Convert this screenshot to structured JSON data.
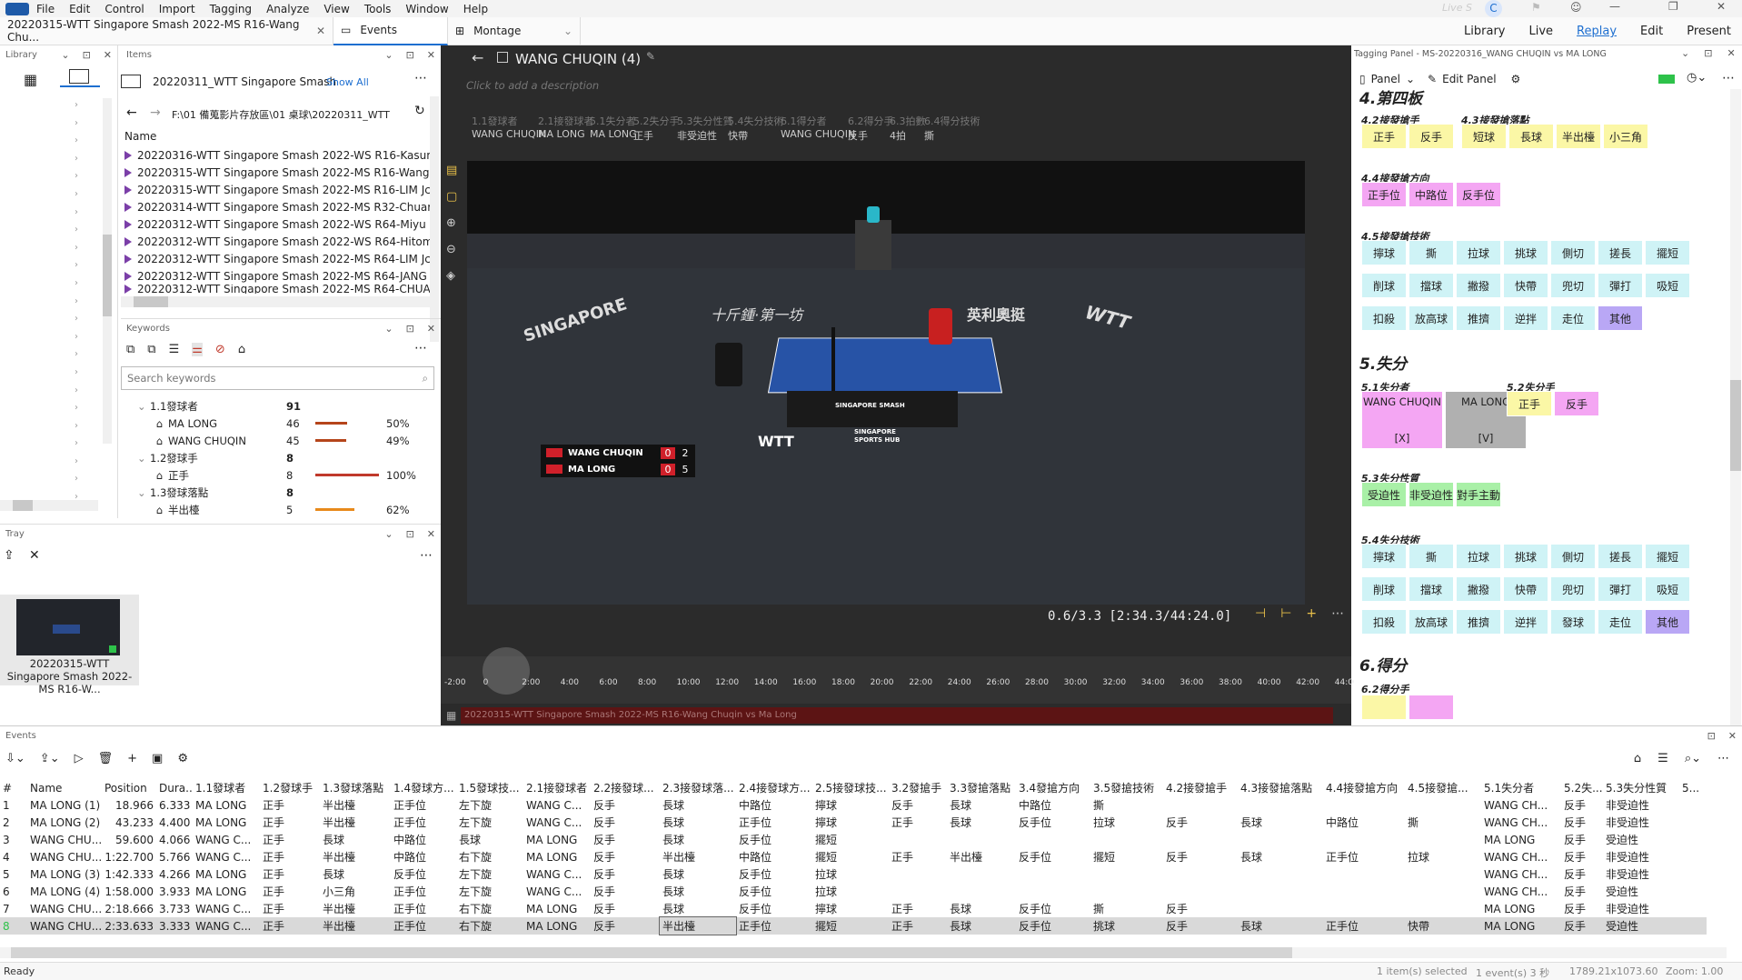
{
  "menu": [
    "File",
    "Edit",
    "Control",
    "Import",
    "Tagging",
    "Analyze",
    "View",
    "Tools",
    "Window",
    "Help"
  ],
  "live_label": "Live S",
  "user_initial": "C",
  "modes": [
    "Library",
    "Live",
    "Replay",
    "Edit",
    "Present"
  ],
  "doc_tab": "20220315-WTT Singapore Smash 2022-MS R16-Wang Chu...",
  "tabs": [
    "Events",
    "Montage"
  ],
  "library": {
    "title": "Library"
  },
  "items": {
    "title": "Items",
    "folder": "20220311_WTT Singapore Smash",
    "show_all": "Show All",
    "path": "F:\\01 備蒐影片存放區\\01 桌球\\20220311_WTT",
    "col_name": "Name",
    "rows": [
      "20220316-WTT Singapore Smash 2022-WS R16-Kasum",
      "20220315-WTT Singapore Smash 2022-MS R16-Wang",
      "20220315-WTT Singapore Smash 2022-MS R16-LIM Jc",
      "20220314-WTT Singapore Smash 2022-MS R32-Chuar",
      "20220312-WTT Singapore Smash 2022-WS R64-Miyu I",
      "20220312-WTT Singapore Smash 2022-WS R64-Hitom",
      "20220312-WTT Singapore Smash 2022-MS R64-LIM Jc",
      "20220312-WTT Singapore Smash 2022-MS R64-JANG",
      "20220312-WTT Singapore Smash 2022-MS R64-CHUA"
    ]
  },
  "keywords": {
    "title": "Keywords",
    "search_placeholder": "Search keywords",
    "rows": [
      {
        "label": "1.1發球者",
        "count": "91",
        "pct": "",
        "level": 0
      },
      {
        "label": "MA LONG",
        "count": "46",
        "pct": "50%",
        "level": 1,
        "fill": 0.5,
        "color": "#b5451b"
      },
      {
        "label": "WANG CHUQIN",
        "count": "45",
        "pct": "49%",
        "level": 1,
        "fill": 0.49,
        "color": "#b5451b"
      },
      {
        "label": "1.2發球手",
        "count": "8",
        "pct": "",
        "level": 0
      },
      {
        "label": "正手",
        "count": "8",
        "pct": "100%",
        "level": 1,
        "fill": 1.0,
        "color": "#c0392b"
      },
      {
        "label": "1.3發球落點",
        "count": "8",
        "pct": "",
        "level": 0
      },
      {
        "label": "半出檯",
        "count": "5",
        "pct": "62%",
        "level": 1,
        "fill": 0.62,
        "color": "#e8891b"
      }
    ]
  },
  "tray": {
    "title": "Tray",
    "thumb_caption": "20220315-WTT Singapore Smash 2022-MS R16-W..."
  },
  "event": {
    "title": "WANG CHUQIN (4)",
    "desc_placeholder": "Click to add a description",
    "meta": [
      {
        "k": "1.1發球者",
        "v": "WANG CHUQIN"
      },
      {
        "k": "2.1接發球者",
        "v": "MA LONG"
      },
      {
        "k": "5.1失分者",
        "v": "MA LONG"
      },
      {
        "k": "5.2失分手",
        "v": "正手"
      },
      {
        "k": "5.3失分性質",
        "v": "非受迫性"
      },
      {
        "k": "5.4失分技術",
        "v": "快帶"
      },
      {
        "k": "6.1得分者",
        "v": "WANG CHUQIN"
      },
      {
        "k": "6.2得分手",
        "v": "反手"
      },
      {
        "k": "6.3拍數",
        "v": "4拍"
      },
      {
        "k": "6.4得分技術",
        "v": "撕"
      }
    ]
  },
  "scoreboard": [
    {
      "name": "WANG CHUQIN",
      "games": "0",
      "points": "2"
    },
    {
      "name": "MA LONG",
      "games": "0",
      "points": "5"
    }
  ],
  "video_text": {
    "singapore": "SINGAPORE",
    "wtt": "WTT",
    "hub": "SINGAPORE SPORTS HUB",
    "cn_left": "十斤鍾·第一坊",
    "cn_right": "英利奧挺",
    "table_brand": "SINGAPORE SMASH"
  },
  "timecode": "0.6/3.3 [2:34.3/44:24.0]",
  "timeline": {
    "ticks": [
      "-2:00",
      "0",
      "2:00",
      "4:00",
      "6:00",
      "8:00",
      "10:00",
      "12:00",
      "14:00",
      "16:00",
      "18:00",
      "20:00",
      "22:00",
      "24:00",
      "26:00",
      "28:00",
      "30:00",
      "32:00",
      "34:00",
      "36:00",
      "38:00",
      "40:00",
      "42:00",
      "44:00"
    ],
    "speed": "1",
    "clip": "20220315-WTT Singapore Smash 2022-MS R16-Wang Chuqin vs Ma Long"
  },
  "tagging": {
    "title": "Tagging Panel - MS-20220316_WANG CHUQIN vs MA LONG",
    "panel": "Panel",
    "edit_panel": "Edit Panel",
    "s4": "4.第四板",
    "s4_2": "4.2接發搶手",
    "s4_3": "4.3接發搶落點",
    "s4_4": "4.4接發搶方向",
    "s4_5": "4.5接發搶技術",
    "b4_2": [
      "正手",
      "反手"
    ],
    "b4_3": [
      "短球",
      "長球",
      "半出檯",
      "小三角"
    ],
    "b4_4": [
      "正手位",
      "中路位",
      "反手位"
    ],
    "tech": [
      "擰球",
      "撕",
      "拉球",
      "挑球",
      "側切",
      "搓長",
      "擺短",
      "削球",
      "擋球",
      "撇撥",
      "快帶",
      "兜切",
      "彈打",
      "吸短",
      "扣殺",
      "放高球",
      "推擠",
      "逆拌",
      "走位",
      "其他"
    ],
    "s5": "5.失分",
    "s5_1": "5.1失分者",
    "s5_2": "5.2失分手",
    "s5_3": "5.3失分性質",
    "s5_4": "5.4失分技術",
    "b5_1": [
      {
        "name": "WANG CHUQIN",
        "mark": "[X]"
      },
      {
        "name": "MA LONG",
        "mark": "[V]"
      }
    ],
    "b5_2": [
      "正手",
      "反手"
    ],
    "b5_3": [
      "受迫性",
      "非受迫性",
      "對手主動"
    ],
    "tech5": [
      "擰球",
      "撕",
      "拉球",
      "挑球",
      "側切",
      "搓長",
      "擺短",
      "削球",
      "擋球",
      "撇撥",
      "快帶",
      "兜切",
      "彈打",
      "吸短",
      "扣殺",
      "放高球",
      "推擠",
      "逆拌",
      "發球",
      "走位",
      "其他"
    ],
    "s6": "6.得分",
    "s6_2": "6.2得分手"
  },
  "events": {
    "title": "Events",
    "cols": [
      "#",
      "Name",
      "Position",
      "Dura...",
      "1.1發球者",
      "1.2發球手",
      "1.3發球落點",
      "1.4發球方...",
      "1.5發球技...",
      "2.1接發球者",
      "2.2接發球...",
      "2.3接發球落...",
      "2.4接發球方...",
      "2.5接發球技...",
      "3.2發搶手",
      "3.3發搶落點",
      "3.4發搶方向",
      "3.5發搶技術",
      "4.2接發搶手",
      "4.3接發搶落點",
      "4.4接發搶方向",
      "4.5接發搶...",
      "5.1失分者",
      "5.2失...",
      "5.3失分性質",
      "5..."
    ],
    "rows": [
      [
        "1",
        "MA LONG (1)",
        "18.966",
        "6.333",
        "MA LONG",
        "正手",
        "半出檯",
        "正手位",
        "左下旋",
        "WANG C...",
        "反手",
        "長球",
        "中路位",
        "擰球",
        "反手",
        "長球",
        "中路位",
        "撕",
        "",
        "",
        "",
        "",
        "WANG CH...",
        "反手",
        "非受迫性",
        ""
      ],
      [
        "2",
        "MA LONG (2)",
        "43.233",
        "4.400",
        "MA LONG",
        "正手",
        "半出檯",
        "正手位",
        "左下旋",
        "WANG C...",
        "反手",
        "長球",
        "正手位",
        "擰球",
        "正手",
        "長球",
        "反手位",
        "拉球",
        "反手",
        "長球",
        "中路位",
        "撕",
        "WANG CH...",
        "反手",
        "非受迫性",
        ""
      ],
      [
        "3",
        "WANG CHU...",
        "59.600",
        "4.066",
        "WANG C...",
        "正手",
        "長球",
        "中路位",
        "長球",
        "MA LONG",
        "反手",
        "長球",
        "反手位",
        "擺短",
        "",
        "",
        "",
        "",
        "",
        "",
        "",
        "",
        "MA LONG",
        "反手",
        "受迫性",
        ""
      ],
      [
        "4",
        "WANG CHU...",
        "1:22.700",
        "5.766",
        "WANG C...",
        "正手",
        "半出檯",
        "中路位",
        "右下旋",
        "MA LONG",
        "反手",
        "半出檯",
        "中路位",
        "擺短",
        "正手",
        "半出檯",
        "反手位",
        "擺短",
        "反手",
        "長球",
        "正手位",
        "拉球",
        "WANG CH...",
        "反手",
        "非受迫性",
        ""
      ],
      [
        "5",
        "MA LONG (3)",
        "1:42.333",
        "4.266",
        "MA LONG",
        "正手",
        "長球",
        "反手位",
        "左下旋",
        "WANG C...",
        "反手",
        "長球",
        "反手位",
        "拉球",
        "",
        "",
        "",
        "",
        "",
        "",
        "",
        "",
        "WANG CH...",
        "反手",
        "非受迫性",
        ""
      ],
      [
        "6",
        "MA LONG (4)",
        "1:58.000",
        "3.933",
        "MA LONG",
        "正手",
        "小三角",
        "正手位",
        "左下旋",
        "WANG C...",
        "反手",
        "長球",
        "反手位",
        "拉球",
        "",
        "",
        "",
        "",
        "",
        "",
        "",
        "",
        "WANG CH...",
        "反手",
        "受迫性",
        ""
      ],
      [
        "7",
        "WANG CHU...",
        "2:18.666",
        "3.733",
        "WANG C...",
        "正手",
        "半出檯",
        "正手位",
        "右下旋",
        "MA LONG",
        "反手",
        "長球",
        "反手位",
        "擰球",
        "正手",
        "長球",
        "反手位",
        "撕",
        "反手",
        "",
        "",
        "",
        "MA LONG",
        "反手",
        "非受迫性",
        ""
      ],
      [
        "8",
        "WANG CHU...",
        "2:33.633",
        "3.333",
        "WANG C...",
        "正手",
        "半出檯",
        "正手位",
        "右下旋",
        "MA LONG",
        "反手",
        "半出檯",
        "正手位",
        "擺短",
        "正手",
        "長球",
        "反手位",
        "挑球",
        "反手",
        "長球",
        "正手位",
        "快帶",
        "MA LONG",
        "反手",
        "受迫性",
        ""
      ]
    ]
  },
  "status": {
    "ready": "Ready",
    "items_selected": "1 item(s) selected",
    "events_selected": "1 event(s) 3 秒",
    "dims": "1789.21x1073.60",
    "zoom": "Zoom: 1.00"
  }
}
